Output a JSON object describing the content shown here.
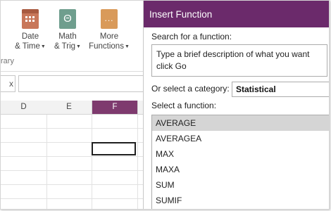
{
  "ribbon": {
    "buttons": [
      {
        "line1": "Date",
        "line2": "& Time",
        "icon": "calendar-icon"
      },
      {
        "line1": "Math",
        "line2": "& Trig",
        "icon": "theta-icon"
      },
      {
        "line1": "More",
        "line2": "Functions",
        "icon": "more-functions-icon"
      }
    ],
    "group_label": "rary",
    "math_glyph": "Θ",
    "more_glyph": "..."
  },
  "formula_bar": {
    "fx_label": "x",
    "value": ""
  },
  "sheet": {
    "columns": [
      "D",
      "E",
      "F"
    ],
    "selected_column": "F"
  },
  "dialog": {
    "title": "Insert Function",
    "search_label": "Search for a function:",
    "search_value_line1": "Type a brief description of what you want",
    "search_value_line2": "click Go",
    "category_label": "Or select a category:",
    "category_value": "Statistical",
    "select_label": "Select a function:",
    "functions": [
      "AVERAGE",
      "AVERAGEA",
      "MAX",
      "MAXA",
      "SUM",
      "SUMIF"
    ],
    "selected_function": "AVERAGE"
  },
  "colors": {
    "title_bar": "#6b2a6b",
    "selected_column": "#7e3a6e"
  }
}
